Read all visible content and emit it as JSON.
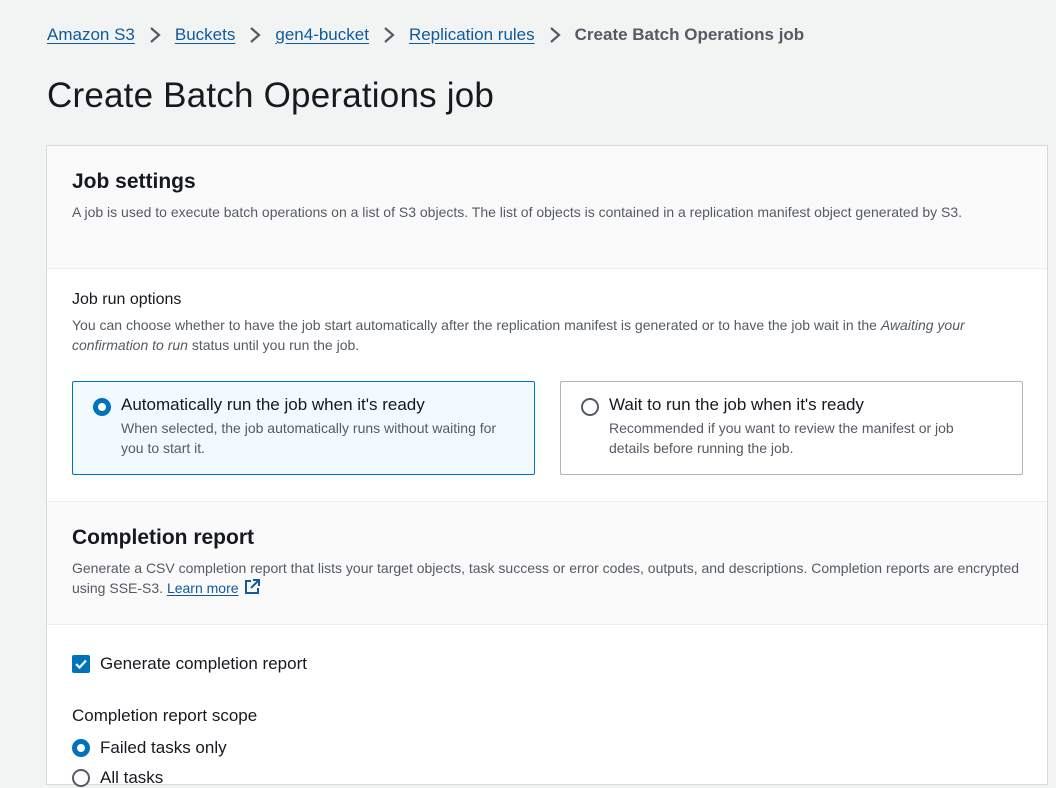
{
  "breadcrumb": {
    "items": [
      "Amazon S3",
      "Buckets",
      "gen4-bucket",
      "Replication rules"
    ],
    "current": "Create Batch Operations job"
  },
  "page": {
    "title": "Create Batch Operations job"
  },
  "job_settings": {
    "heading": "Job settings",
    "description": "A job is used to execute batch operations on a list of S3 objects. The list of objects is contained in a replication manifest object generated by S3."
  },
  "run_options": {
    "label": "Job run options",
    "description_before": "You can choose whether to have the job start automatically after the replication manifest is generated or to have the job wait in the",
    "description_italic": "Awaiting your confirmation to run",
    "description_after": "status until you run the job.",
    "options": [
      {
        "title": "Automatically run the job when it's ready",
        "description": "When selected, the job automatically runs without waiting for you to start it.",
        "selected": true
      },
      {
        "title": "Wait to run the job when it's ready",
        "description": "Recommended if you want to review the manifest or job details before running the job.",
        "selected": false
      }
    ]
  },
  "completion_report": {
    "heading": "Completion report",
    "description": "Generate a CSV completion report that lists your target objects, task success or error codes, outputs, and descriptions. Completion reports are encrypted using SSE-S3.",
    "learn_more": "Learn more",
    "generate_label": "Generate completion report",
    "generate_checked": true,
    "scope_label": "Completion report scope",
    "scope_options": [
      {
        "label": "Failed tasks only",
        "selected": true
      },
      {
        "label": "All tasks",
        "selected": false
      }
    ]
  },
  "colors": {
    "link": "#0f5a9c",
    "accent": "#0073bb",
    "selected_tile_bg": "#f1faff",
    "page_bg": "#f2f3f3"
  },
  "icons": [
    "chevron-right-icon",
    "external-link-icon",
    "checkmark-icon"
  ]
}
